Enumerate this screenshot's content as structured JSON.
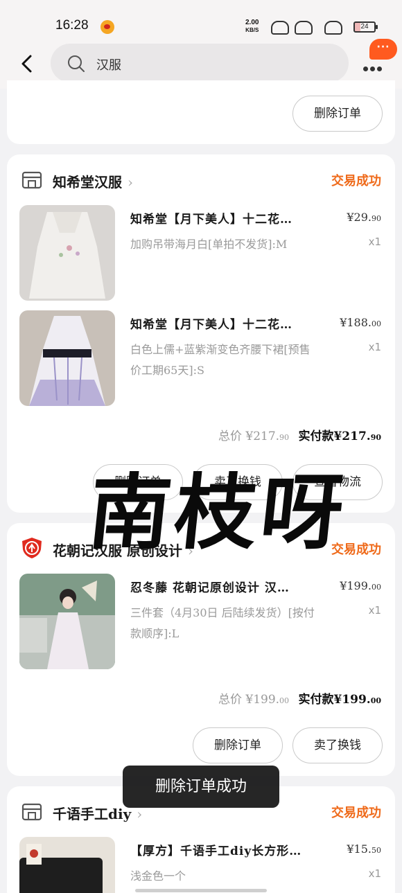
{
  "status_bar": {
    "time": "16:28",
    "net_speed": "2.00",
    "net_unit": "KB/S",
    "battery": "24"
  },
  "header": {
    "search_value": "汉服",
    "more_badge": "···"
  },
  "prev_card": {
    "delete_button": "删除订单"
  },
  "orders": [
    {
      "shop_name": "知希堂汉服",
      "status": "交易成功",
      "items": [
        {
          "title": "知希堂【月下美人】十二花…",
          "price_int": "¥29.",
          "price_dec": "90",
          "sku": "加购吊带海月白[单拍不发货]:M",
          "qty": "x1"
        },
        {
          "title": "知希堂【月下美人】十二花…",
          "price_int": "¥188.",
          "price_dec": "00",
          "sku": "白色上儒+蓝紫渐变色齐腰下裙[预售价工期65天]:S",
          "qty": "x1"
        }
      ],
      "total_label": "总价",
      "total_int": "¥217.",
      "total_dec": "90",
      "paid_label": "实付款",
      "paid_int": "¥217.",
      "paid_dec": "90",
      "buttons": [
        "删除订单",
        "卖了换钱",
        "查看物流"
      ]
    },
    {
      "shop_name": "花朝记汉服 原创设计",
      "status": "交易成功",
      "items": [
        {
          "title": "忍冬藤 花朝记原创设计 汉…",
          "price_int": "¥199.",
          "price_dec": "00",
          "sku": "三件套（4月30日 后陆续发货）[按付款顺序]:L",
          "qty": "x1"
        }
      ],
      "total_label": "总价",
      "total_int": "¥199.",
      "total_dec": "00",
      "paid_label": "实付款",
      "paid_int": "¥199.",
      "paid_dec": "00",
      "buttons": [
        "删除订单",
        "卖了换钱"
      ]
    },
    {
      "shop_name": "千语手工diy",
      "status": "交易成功",
      "items": [
        {
          "title": "【厚方】千语手工diy长方形…",
          "price_int": "¥15.",
          "price_dec": "50",
          "sku": "浅金色一个",
          "qty": "x1"
        }
      ]
    }
  ],
  "toast": "删除订单成功",
  "watermark": "南枝呀",
  "colors": {
    "accent": "#ef6a1a",
    "badge": "#ff5a1f",
    "page_bg": "#f2f2f4"
  },
  "icons": {
    "back": "chevron-left-icon",
    "search": "search-icon",
    "more": "more-dots-icon",
    "store": "store-icon",
    "shield": "shield-brand-icon",
    "chevron": "chevron-right-icon"
  }
}
